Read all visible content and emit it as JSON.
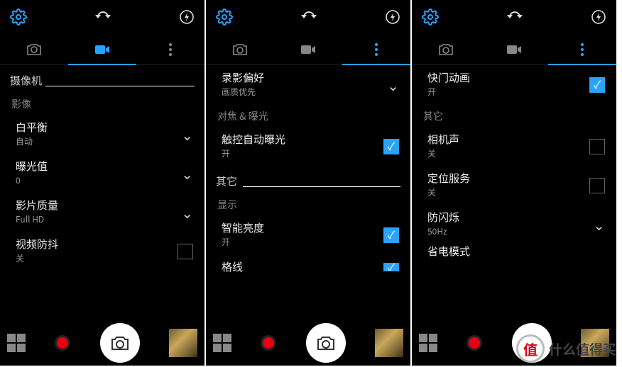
{
  "panel1": {
    "section": "摄像机",
    "subhead1": "影像",
    "items": [
      {
        "title": "白平衡",
        "sub": "自动",
        "ctrl": "chev"
      },
      {
        "title": "曝光值",
        "sub": "0",
        "ctrl": "chev"
      },
      {
        "title": "影片质量",
        "sub": "Full HD",
        "ctrl": "chev"
      },
      {
        "title": "视频防抖",
        "sub": "关",
        "ctrl": "checkbox-off"
      }
    ],
    "activeTab": 1
  },
  "panel2": {
    "items_a": [
      {
        "title": "录影偏好",
        "sub": "画质优先",
        "ctrl": "chev"
      }
    ],
    "subhead_a": "对焦 & 曝光",
    "items_b": [
      {
        "title": "触控自动曝光",
        "sub": "开",
        "ctrl": "checkbox-on"
      }
    ],
    "section": "其它",
    "subhead_b": "显示",
    "items_c": [
      {
        "title": "智能亮度",
        "sub": "开",
        "ctrl": "checkbox-on"
      },
      {
        "title": "格线",
        "sub": "",
        "ctrl": "checkbox-on"
      }
    ],
    "activeTab": 2
  },
  "panel3": {
    "items_a": [
      {
        "title": "快门动画",
        "sub": "开",
        "ctrl": "checkbox-on"
      }
    ],
    "subhead_a": "其它",
    "items_b": [
      {
        "title": "相机声",
        "sub": "关",
        "ctrl": "checkbox-off"
      },
      {
        "title": "定位服务",
        "sub": "关",
        "ctrl": "checkbox-off"
      },
      {
        "title": "防闪烁",
        "sub": "50Hz",
        "ctrl": "chev"
      }
    ],
    "cutoff": "省电模式",
    "activeTab": 2
  },
  "watermark": "什么值得买"
}
